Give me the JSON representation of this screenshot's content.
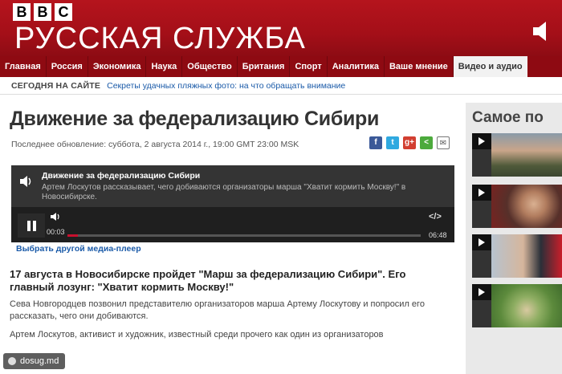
{
  "header": {
    "logo_letters": [
      "B",
      "B",
      "C"
    ],
    "service_title": "РУССКАЯ СЛУЖБА",
    "brand_color": "#a40f18"
  },
  "nav": {
    "items": [
      "Главная",
      "Россия",
      "Экономика",
      "Наука",
      "Общество",
      "Британия",
      "Спорт",
      "Аналитика",
      "Ваше мнение",
      "Видео и аудио"
    ],
    "active": "Видео и аудио"
  },
  "today": {
    "label": "СЕГОДНЯ НА САЙТЕ",
    "link": "Секреты удачных пляжных фото: на что обращать внимание"
  },
  "article": {
    "headline": "Движение за федерализацию Сибири",
    "updated": "Последнее обновление: суббота, 2 августа 2014 г., 19:00 GMT 23:00 MSK",
    "share_icons": [
      "facebook-icon",
      "twitter-icon",
      "google-plus-icon",
      "share-icon",
      "email-icon"
    ],
    "lead": "17 августа в Новосибирске пройдет \"Марш за федерализацию Сибири\". Его главный лозунг: \"Хватит кормить Москву!\"",
    "para1": "Сева Новгородцев позвонил представителю организаторов марша Артему Лоскутову и попросил его рассказать, чего они добиваются.",
    "para2": "Артем Лоскутов, активист и художник, известный среди прочего как один из организаторов"
  },
  "player": {
    "title": "Движение за федерализацию Сибири",
    "description": "Артем Лоскутов рассказывает, чего добиваются организаторы марша \"Хватит кормить Москву!\" в Новосибирске.",
    "time_current": "00:03",
    "time_total": "06:48",
    "progress_fraction": 0.03,
    "embed_label": "</>",
    "change_player_link": "Выбрать другой медиа-плеер"
  },
  "sidebar": {
    "title": "Самое по",
    "items": [
      "video-thumb-1",
      "video-thumb-2",
      "video-thumb-3",
      "video-thumb-4"
    ]
  },
  "watermark": "dosug.md"
}
